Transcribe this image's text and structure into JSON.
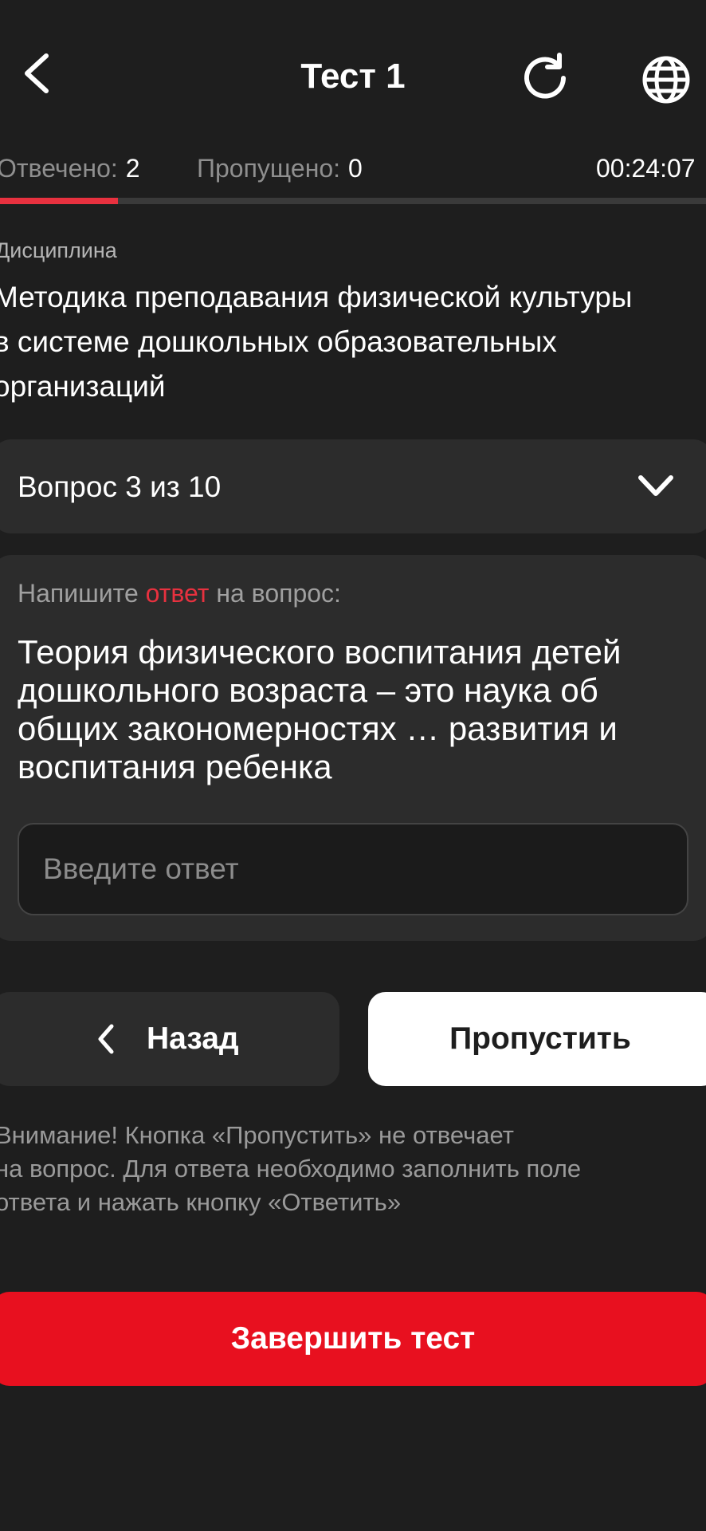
{
  "header": {
    "title": "Тест 1",
    "back_icon": "chevron-left-icon",
    "reload_icon": "reload-icon",
    "language_icon": "globe-icon"
  },
  "stats": {
    "answered_label": "Отвечено:",
    "answered_value": "2",
    "skipped_label": "Пропущено:",
    "skipped_value": "0",
    "timer": "00:24:07"
  },
  "progress": {
    "fraction": 0.167
  },
  "discipline": {
    "label": "Дисциплина",
    "line1": "Методика преподавания физической культуры",
    "line2": "в системе дошкольных образовательных",
    "line3": "организаций"
  },
  "question_selector": {
    "label": "Вопрос 3 из 10",
    "icon": "chevron-down-icon"
  },
  "question": {
    "prompt_before": "Напишите ",
    "prompt_accent": "ответ",
    "prompt_after": " на вопрос:",
    "text": "Теория физического воспитания детей дошкольного возраста – это наука об общих закономерностях … развития и воспитания ребенка",
    "answer_value": "",
    "answer_placeholder": "Введите ответ"
  },
  "buttons": {
    "back_label": "Назад",
    "skip_label": "Пропустить",
    "finish_label": "Завершить тест"
  },
  "warning": {
    "line1": "Внимание! Кнопка «Пропустить» не отвечает",
    "line2": "на вопрос. Для ответа необходимо заполнить поле",
    "line3": "ответа и нажать кнопку «Ответить»"
  },
  "colors": {
    "background": "#1e1e1e",
    "card": "#2c2c2c",
    "accent": "#e8313f",
    "finish_button": "#e8101f"
  }
}
